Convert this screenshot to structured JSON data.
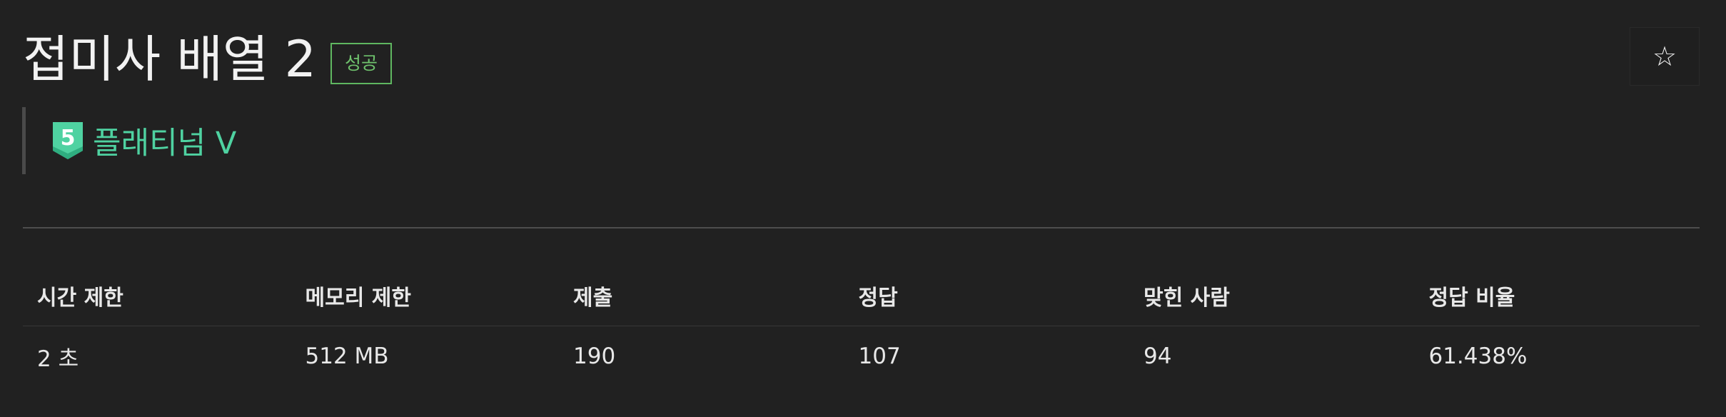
{
  "problem": {
    "title": "접미사 배열 2",
    "result_badge": "성공",
    "tier": {
      "level_number": "5",
      "label": "플래티넘 V",
      "color": "#4fd2a1"
    }
  },
  "actions": {
    "favorite_icon": "star-outline-icon",
    "favorite_glyph": "☆"
  },
  "stats": {
    "headers": [
      "시간 제한",
      "메모리 제한",
      "제출",
      "정답",
      "맞힌 사람",
      "정답 비율"
    ],
    "values": [
      "2 초",
      "512 MB",
      "190",
      "107",
      "94",
      "61.438%"
    ]
  },
  "colors": {
    "background": "#212121",
    "success": "#6fc26d",
    "tier": "#4fd2a1"
  }
}
